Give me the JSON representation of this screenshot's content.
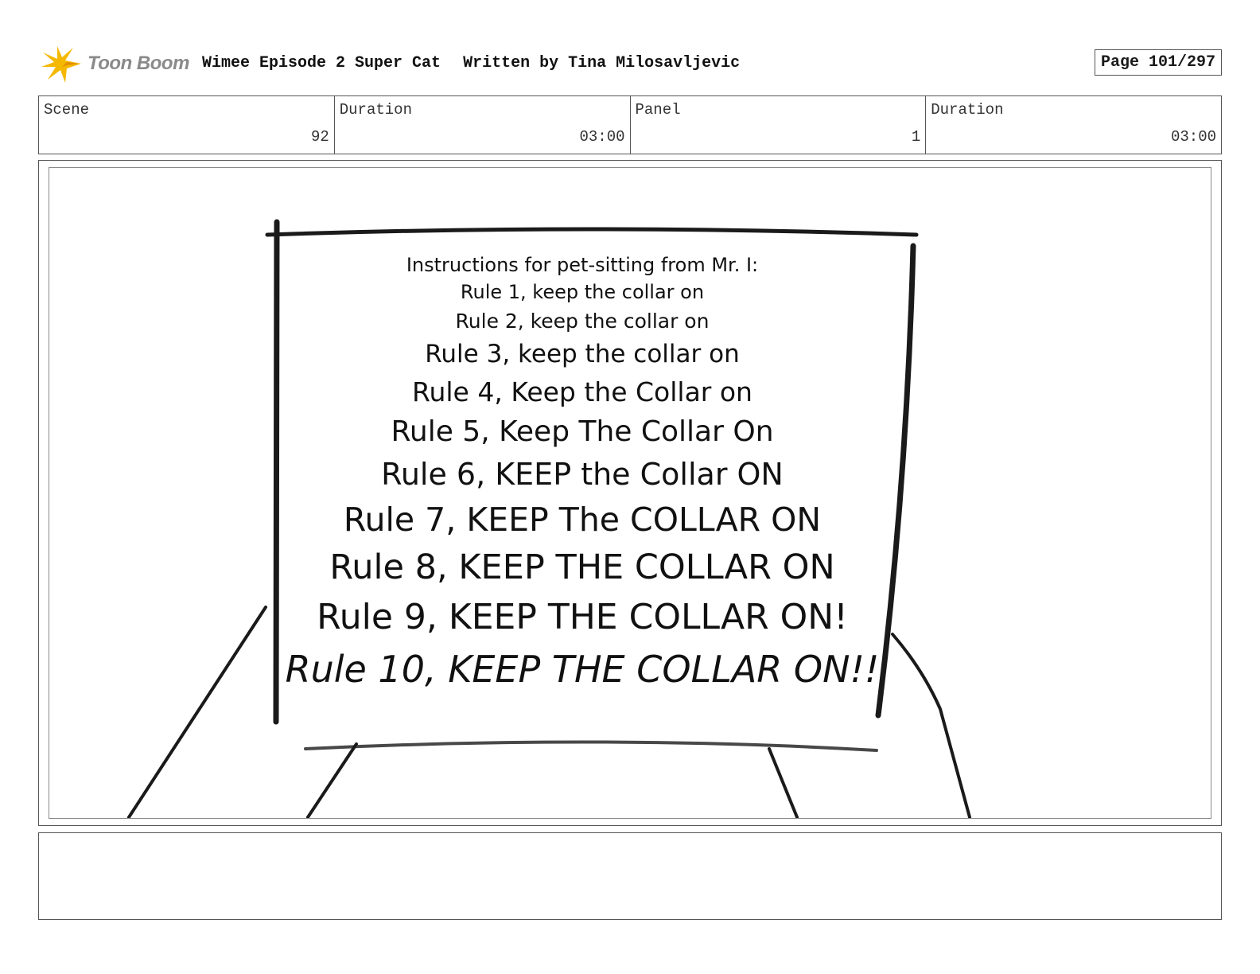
{
  "header": {
    "logo_text": "Toon Boom",
    "title": "Wimee Episode 2 Super Cat",
    "written_by": "Written by Tina Milosavljevic",
    "page": "Page 101/297"
  },
  "info": {
    "scene_label": "Scene",
    "scene_value": "92",
    "duration1_label": "Duration",
    "duration1_value": "03:00",
    "panel_label": "Panel",
    "panel_value": "1",
    "duration2_label": "Duration",
    "duration2_value": "03:00"
  },
  "sign": {
    "lines": [
      "Instructions for pet-sitting from Mr. I:",
      "Rule 1, keep the collar on",
      "Rule 2, keep the collar on",
      "Rule 3, keep the collar on",
      "Rule 4, Keep the Collar on",
      "Rule 5, Keep The Collar On",
      "Rule 6, KEEP the Collar ON",
      "Rule 7, KEEP The COLLAR ON",
      "Rule 8, KEEP THE COLLAR ON",
      "Rule 9, KEEP THE COLLAR ON!",
      "Rule 10, KEEP THE COLLAR ON!!"
    ]
  },
  "colors": {
    "logo_star": "#f5b800",
    "ink": "#1a1a1a",
    "border": "#555555"
  }
}
